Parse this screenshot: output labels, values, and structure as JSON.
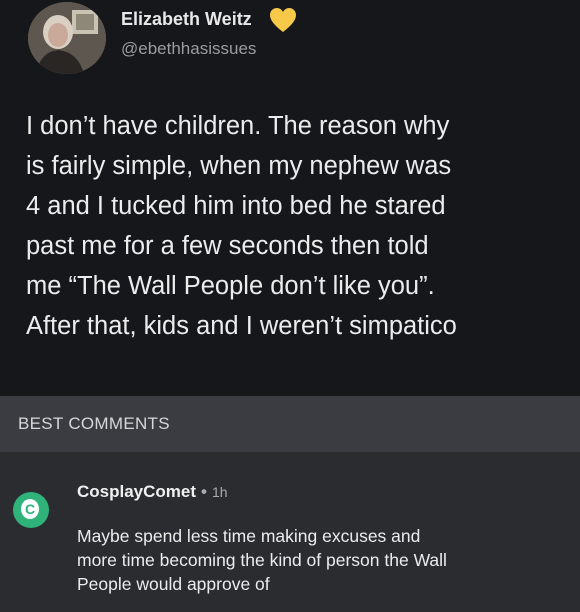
{
  "tweet": {
    "author_name": "Elizabeth Weitz",
    "handle": "@ebethhasissues",
    "badge_icon": "yellow-heart-icon",
    "badge_color": "#f6c949",
    "lines": [
      "I don’t have children. The reason why",
      "is fairly simple, when my nephew was",
      "4 and I tucked him into bed he stared",
      "past me for a few seconds then told",
      "me “The Wall People don’t like you”.",
      "After that, kids and I weren’t simpatico"
    ]
  },
  "comments": {
    "section_title": "BEST COMMENTS",
    "items": [
      {
        "avatar_initial": "C",
        "avatar_color": "#2fb37a",
        "user": "CosplayComet",
        "separator": "•",
        "time": "1h",
        "lines": [
          "Maybe spend less time making excuses and",
          "more time becoming the kind of person the Wall",
          "People would approve of"
        ]
      }
    ]
  }
}
